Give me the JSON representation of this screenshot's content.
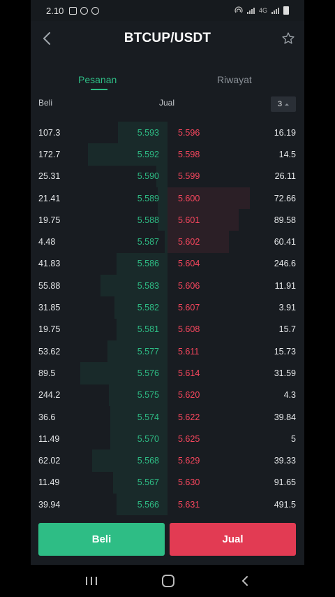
{
  "status_bar": {
    "time": "2.10",
    "network": "4G"
  },
  "header": {
    "title": "BTCUP/USDT"
  },
  "tabs": {
    "orders": "Pesanan",
    "history": "Riwayat"
  },
  "columns": {
    "buy": "Beli",
    "sell": "Jual",
    "precision": "3"
  },
  "colors": {
    "bid": "#2ebd85",
    "ask": "#f6465d",
    "background": "#181c21"
  },
  "order_book": [
    {
      "bid_qty": "107.3",
      "bid_price": "5.593",
      "ask_price": "5.596",
      "ask_qty": "16.19",
      "bid_depth": 0.36,
      "ask_depth": 0.0
    },
    {
      "bid_qty": "172.7",
      "bid_price": "5.592",
      "ask_price": "5.598",
      "ask_qty": "14.5",
      "bid_depth": 0.58,
      "ask_depth": 0.0
    },
    {
      "bid_qty": "25.31",
      "bid_price": "5.590",
      "ask_price": "5.599",
      "ask_qty": "26.11",
      "bid_depth": 0.08,
      "ask_depth": 0.0
    },
    {
      "bid_qty": "21.41",
      "bid_price": "5.589",
      "ask_price": "5.600",
      "ask_qty": "72.66",
      "bid_depth": 0.07,
      "ask_depth": 0.6
    },
    {
      "bid_qty": "19.75",
      "bid_price": "5.588",
      "ask_price": "5.601",
      "ask_qty": "89.58",
      "bid_depth": 0.07,
      "ask_depth": 0.52
    },
    {
      "bid_qty": "4.48",
      "bid_price": "5.587",
      "ask_price": "5.602",
      "ask_qty": "60.41",
      "bid_depth": 0.02,
      "ask_depth": 0.45
    },
    {
      "bid_qty": "41.83",
      "bid_price": "5.586",
      "ask_price": "5.604",
      "ask_qty": "246.6",
      "bid_depth": 0.37,
      "ask_depth": 0.0
    },
    {
      "bid_qty": "55.88",
      "bid_price": "5.583",
      "ask_price": "5.606",
      "ask_qty": "11.91",
      "bid_depth": 0.49,
      "ask_depth": 0.0
    },
    {
      "bid_qty": "31.85",
      "bid_price": "5.582",
      "ask_price": "5.607",
      "ask_qty": "3.91",
      "bid_depth": 0.39,
      "ask_depth": 0.0
    },
    {
      "bid_qty": "19.75",
      "bid_price": "5.581",
      "ask_price": "5.608",
      "ask_qty": "15.7",
      "bid_depth": 0.37,
      "ask_depth": 0.0
    },
    {
      "bid_qty": "53.62",
      "bid_price": "5.577",
      "ask_price": "5.611",
      "ask_qty": "15.73",
      "bid_depth": 0.44,
      "ask_depth": 0.0
    },
    {
      "bid_qty": "89.5",
      "bid_price": "5.576",
      "ask_price": "5.614",
      "ask_qty": "31.59",
      "bid_depth": 0.64,
      "ask_depth": 0.0
    },
    {
      "bid_qty": "244.2",
      "bid_price": "5.575",
      "ask_price": "5.620",
      "ask_qty": "4.3",
      "bid_depth": 0.43,
      "ask_depth": 0.0
    },
    {
      "bid_qty": "36.6",
      "bid_price": "5.574",
      "ask_price": "5.622",
      "ask_qty": "39.84",
      "bid_depth": 0.42,
      "ask_depth": 0.0
    },
    {
      "bid_qty": "11.49",
      "bid_price": "5.570",
      "ask_price": "5.625",
      "ask_qty": "5",
      "bid_depth": 0.42,
      "ask_depth": 0.0
    },
    {
      "bid_qty": "62.02",
      "bid_price": "5.568",
      "ask_price": "5.629",
      "ask_qty": "39.33",
      "bid_depth": 0.55,
      "ask_depth": 0.0
    },
    {
      "bid_qty": "11.49",
      "bid_price": "5.567",
      "ask_price": "5.630",
      "ask_qty": "91.65",
      "bid_depth": 0.4,
      "ask_depth": 0.0
    },
    {
      "bid_qty": "39.94",
      "bid_price": "5.566",
      "ask_price": "5.631",
      "ask_qty": "491.5",
      "bid_depth": 0.37,
      "ask_depth": 0.0
    }
  ],
  "actions": {
    "buy": "Beli",
    "sell": "Jual"
  },
  "icons": {
    "back": "back-arrow-icon",
    "favorite": "star-icon"
  }
}
